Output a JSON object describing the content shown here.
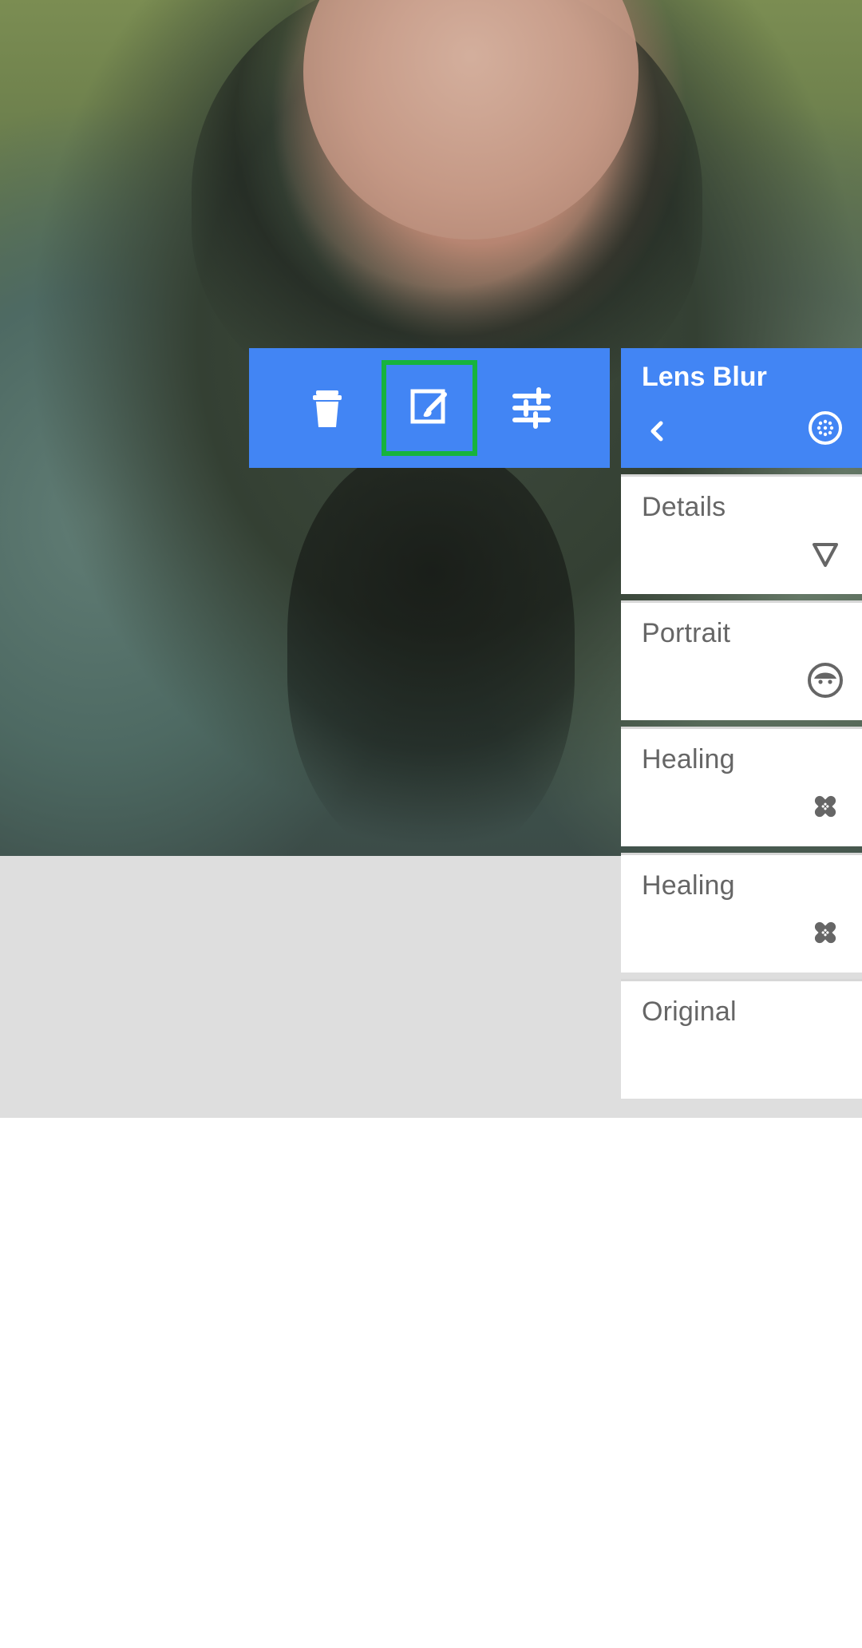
{
  "toolbar": {
    "icons": [
      "trash-icon",
      "brush-edit-icon",
      "tune-sliders-icon"
    ],
    "selected_index": 1,
    "accent_color": "#4285f4",
    "selection_color": "#17b33d"
  },
  "history_panel": {
    "header": {
      "title": "Lens Blur",
      "back_icon": "chevron-left-icon",
      "icon": "lens-blur-icon"
    },
    "items": [
      {
        "label": "Details",
        "icon": "details-triangle-icon"
      },
      {
        "label": "Portrait",
        "icon": "portrait-face-icon"
      },
      {
        "label": "Healing",
        "icon": "healing-bandage-icon"
      },
      {
        "label": "Healing",
        "icon": "healing-bandage-icon"
      },
      {
        "label": "Original",
        "icon": ""
      }
    ],
    "text_color": "#666666"
  }
}
